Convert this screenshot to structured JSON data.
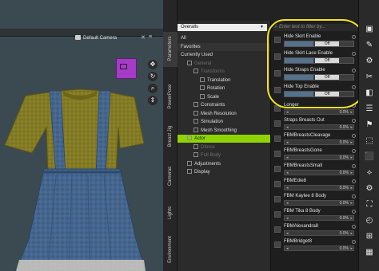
{
  "viewport": {
    "camera_label": "Default Camera",
    "close_glyph": "✕",
    "menu_glyph": "≡",
    "tools": [
      "✥",
      "↻",
      "⌕",
      "⇕"
    ]
  },
  "vtabs": [
    "Parameters",
    "PowerPose",
    "Breast Jig",
    "Cameras",
    "Lights",
    "Environment"
  ],
  "tree": {
    "dropdown": "Overalls",
    "rows": [
      {
        "label": "All",
        "indent": 0,
        "state": "normal"
      },
      {
        "label": "Favorites",
        "indent": 0,
        "state": "band"
      },
      {
        "label": "Currently Used",
        "indent": 0,
        "state": "normal"
      },
      {
        "label": "General",
        "indent": 1,
        "state": "dim"
      },
      {
        "label": "Transforms",
        "indent": 2,
        "state": "dim"
      },
      {
        "label": "Translation",
        "indent": 3,
        "state": "normal"
      },
      {
        "label": "Rotation",
        "indent": 3,
        "state": "normal"
      },
      {
        "label": "Scale",
        "indent": 3,
        "state": "normal"
      },
      {
        "label": "Constraints",
        "indent": 2,
        "state": "normal"
      },
      {
        "label": "Mesh Resolution",
        "indent": 2,
        "state": "normal"
      },
      {
        "label": "Simulation",
        "indent": 2,
        "state": "normal"
      },
      {
        "label": "Mesh Smoothing",
        "indent": 2,
        "state": "normal"
      },
      {
        "label": "Actor",
        "indent": 1,
        "state": "sel"
      },
      {
        "label": "Dforce",
        "indent": 2,
        "state": "dim"
      },
      {
        "label": "Full Body",
        "indent": 2,
        "state": "dim"
      },
      {
        "label": "Adjustments",
        "indent": 1,
        "state": "normal"
      },
      {
        "label": "Display",
        "indent": 1,
        "state": "normal"
      }
    ]
  },
  "props": {
    "filter_placeholder": "Enter text to filter by...",
    "toggles": [
      {
        "label": "Hide Skirt Enable",
        "value": "Off"
      },
      {
        "label": "Hide Skirt Lace Enable",
        "value": "Off"
      },
      {
        "label": "Hide Straps Enable",
        "value": "Off"
      },
      {
        "label": "Hide Top Enable",
        "value": "Off"
      }
    ],
    "sliders": [
      {
        "label": "Longer",
        "value": "0.0%"
      },
      {
        "label": "Straps Breasts Out",
        "value": "0.0%"
      },
      {
        "label": "FBMBreastsCleavage",
        "value": "0.0%"
      },
      {
        "label": "FBMBreastsGone",
        "value": "0.0%"
      },
      {
        "label": "FBMBreastsSmall",
        "value": "0.0%"
      },
      {
        "label": "FBMEdie8",
        "value": "0.0%"
      },
      {
        "label": "FBM Kaylee 8 Body",
        "value": "0.0%"
      },
      {
        "label": "FBM Tika 8 Body",
        "value": "0.0%"
      },
      {
        "label": "FBMAlexandra8",
        "value": "0.0%"
      },
      {
        "label": "FBMBridget8",
        "value": "0.0%"
      }
    ]
  },
  "rtools": [
    "▣",
    "✎",
    "⚙",
    "✂",
    "◧",
    "☰",
    "⚑",
    "⬚",
    "⬛",
    "⟡",
    "⚙",
    "⛶",
    "◴",
    "⊞",
    "▦"
  ],
  "colors": {
    "highlight": "#f2e51c",
    "selected_row": "#8fd400",
    "viewport_bg": "#3b4a50",
    "cube": "#a43cc8"
  }
}
